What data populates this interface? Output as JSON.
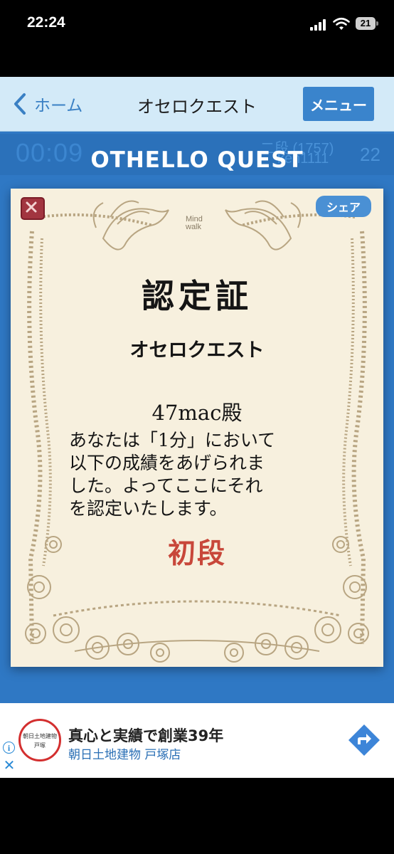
{
  "status_bar": {
    "time": "22:24",
    "battery": "21",
    "icons": [
      "cellular-signal-icon",
      "wifi-icon",
      "battery-icon"
    ]
  },
  "nav": {
    "back_label": "ホーム",
    "title": "オセロクエスト",
    "menu_label": "メニュー"
  },
  "background_game": {
    "timer": "00:09",
    "rank": "二段 (1757)",
    "user": "ken1111",
    "count": "22"
  },
  "app_title": "OTHELLO QUEST",
  "certificate": {
    "share_label": "シェア",
    "logo_line1": "Mind",
    "logo_line2": "walk",
    "heading": "認定証",
    "subtitle": "オセロクエスト",
    "recipient": "47mac殿",
    "body_lines": [
      "あなたは「1分」において",
      "以下の成績をあげられま",
      "した。よってここにそれ",
      "を認定いたします。"
    ],
    "rank": "初段",
    "rank_color": "#c8473a",
    "close_icon": "close-icon"
  },
  "ad": {
    "logo_line1": "朝日土地建物",
    "logo_line2": "戸塚",
    "title": "真心と実績で創業39年",
    "subtitle": "朝日土地建物 戸塚店",
    "info_label": "i",
    "close_label": "✕",
    "nav_icon": "directions-icon"
  },
  "colors": {
    "navbar_bg": "#d3eaf8",
    "accent_blue": "#3a84cc",
    "app_bg": "#2f78c4",
    "certificate_bg": "#f7f0de",
    "frame": "#b8a582"
  }
}
